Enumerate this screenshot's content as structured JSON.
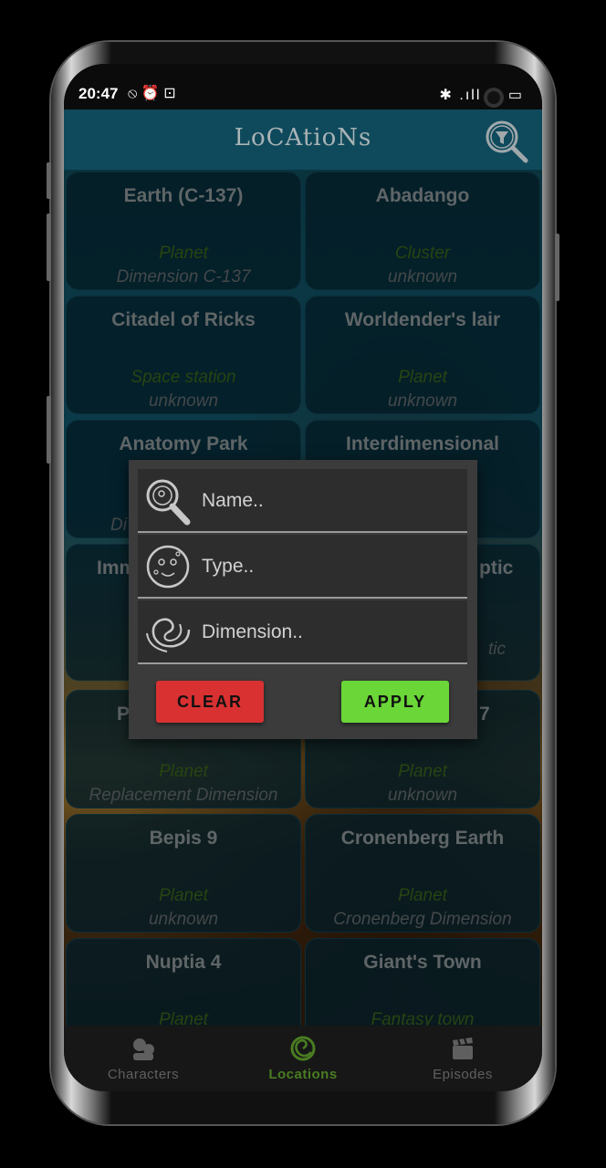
{
  "status_bar": {
    "time": "20:47",
    "right_icons": "✱ .ıll ᯤ ▭"
  },
  "app_bar": {
    "title": "LoCAtioNs"
  },
  "locations": [
    {
      "name": "Earth (C-137)",
      "type": "Planet",
      "dimension": "Dimension C-137"
    },
    {
      "name": "Abadango",
      "type": "Cluster",
      "dimension": "unknown"
    },
    {
      "name": "Citadel of Ricks",
      "type": "Space station",
      "dimension": "unknown"
    },
    {
      "name": "Worldender's lair",
      "type": "Planet",
      "dimension": "unknown"
    },
    {
      "name": "Anatomy Park",
      "type": "",
      "dimension": "Di"
    },
    {
      "name": "Interdimensional",
      "type": "",
      "dimension": ""
    },
    {
      "name": "Imm",
      "type": "",
      "dimension": ""
    },
    {
      "name": "ptic",
      "type": "",
      "dimension": "tic"
    },
    {
      "name": "P",
      "type": "Planet",
      "dimension": "Replacement Dimension"
    },
    {
      "name": "7",
      "type": "Planet",
      "dimension": "unknown"
    },
    {
      "name": "Bepis 9",
      "type": "Planet",
      "dimension": "unknown"
    },
    {
      "name": "Cronenberg Earth",
      "type": "Planet",
      "dimension": "Cronenberg Dimension"
    },
    {
      "name": "Nuptia 4",
      "type": "Planet",
      "dimension": ""
    },
    {
      "name": "Giant's Town",
      "type": "Fantasy town",
      "dimension": ""
    }
  ],
  "filter_dialog": {
    "name_placeholder": "Name..",
    "type_placeholder": "Type..",
    "dimension_placeholder": "Dimension..",
    "clear_label": "CLEAR",
    "apply_label": "APPLY"
  },
  "bottom_nav": [
    {
      "label": "Characters",
      "active": false
    },
    {
      "label": "Locations",
      "active": true
    },
    {
      "label": "Episodes",
      "active": false
    }
  ],
  "colors": {
    "accent_green": "#6ad637",
    "clear_red": "#d93131",
    "type_green": "#3f6e1c"
  }
}
